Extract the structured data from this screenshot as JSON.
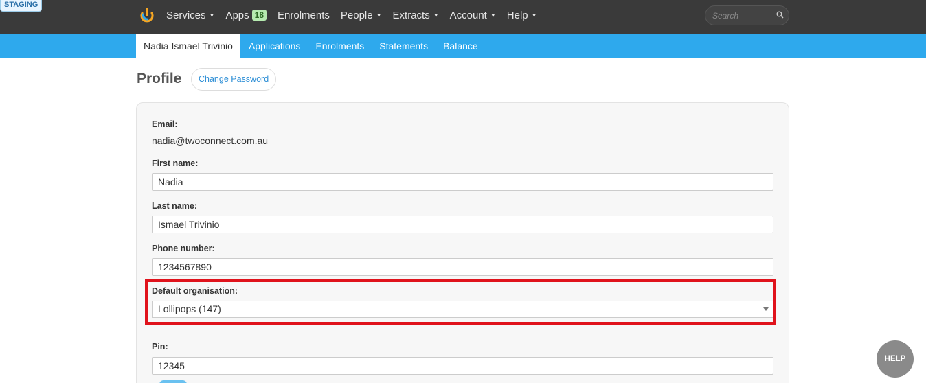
{
  "env_badge": "STAGING",
  "nav": {
    "items": [
      {
        "label": "Services",
        "has_caret": true
      },
      {
        "label": "Apps",
        "badge": "18"
      },
      {
        "label": "Enrolments"
      },
      {
        "label": "People",
        "has_caret": true
      },
      {
        "label": "Extracts",
        "has_caret": true
      },
      {
        "label": "Account",
        "has_caret": true
      },
      {
        "label": "Help",
        "has_caret": true
      }
    ],
    "search_placeholder": "Search"
  },
  "subnav": {
    "tabs": [
      "Nadia Ismael Trivinio",
      "Applications",
      "Enrolments",
      "Statements",
      "Balance"
    ],
    "active": 0
  },
  "page": {
    "title": "Profile",
    "change_password": "Change Password"
  },
  "form": {
    "email_label": "Email:",
    "email_value": "nadia@twoconnect.com.au",
    "first_name_label": "First name:",
    "first_name_value": "Nadia",
    "last_name_label": "Last name:",
    "last_name_value": "Ismael Trivinio",
    "phone_label": "Phone number:",
    "phone_value": "1234567890",
    "org_label": "Default organisation:",
    "org_value": "Lollipops (147)",
    "pin_label": "Pin:",
    "pin_value": "12345"
  },
  "help_button": "HELP",
  "colors": {
    "topbar": "#3a3a3a",
    "subbar": "#2ea9ed",
    "highlight": "#e0131c",
    "apps_badge": "#b6ebb0"
  }
}
